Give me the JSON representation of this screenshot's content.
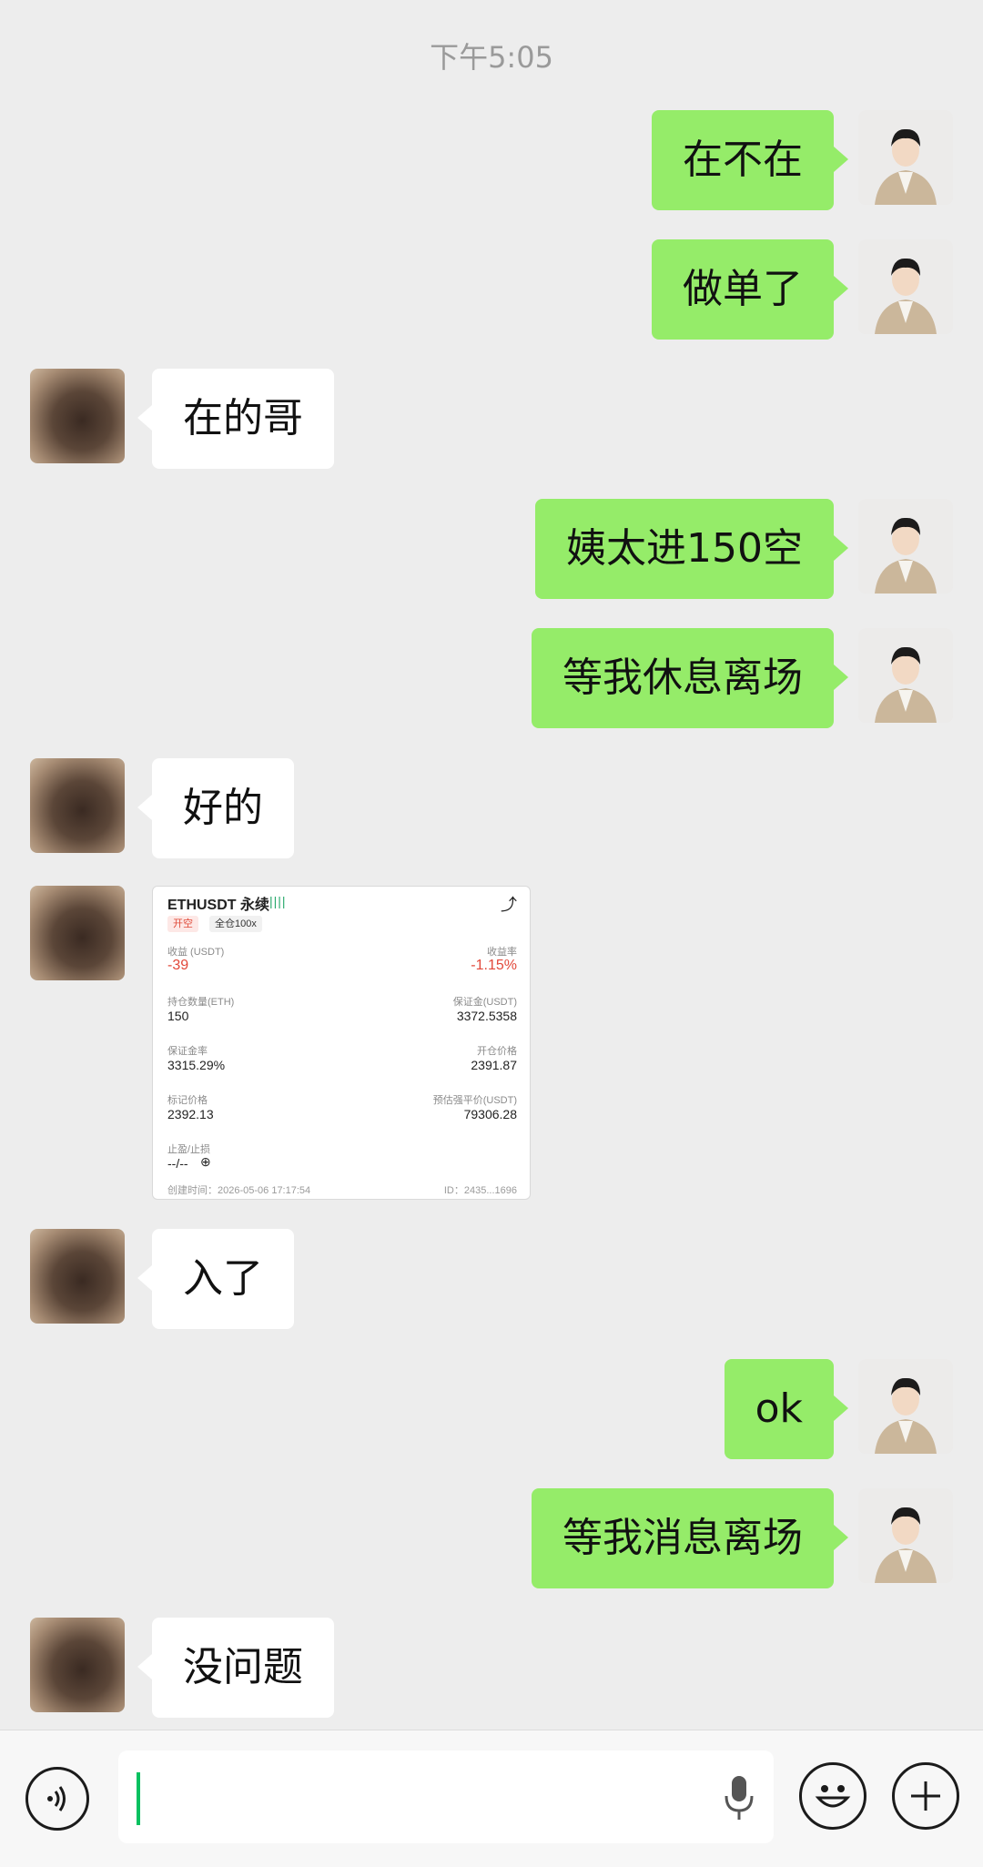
{
  "timestamp": "下午5:05",
  "messages": [
    {
      "side": "me",
      "text": "在不在"
    },
    {
      "side": "me",
      "text": "做单了"
    },
    {
      "side": "peer",
      "text": "在的哥"
    },
    {
      "side": "me",
      "text": "姨太进150空"
    },
    {
      "side": "me",
      "text": "等我休息离场"
    },
    {
      "side": "peer",
      "text": "好的"
    },
    {
      "side": "peer",
      "text": "入了"
    },
    {
      "side": "me",
      "text": "ok"
    },
    {
      "side": "me",
      "text": "等我消息离场"
    },
    {
      "side": "peer",
      "text": "没问题"
    }
  ],
  "card": {
    "title": "ETHUSDT 永续",
    "bars": "||||",
    "share_icon": "share-icon",
    "tag_open": "开空",
    "tag_cross": "全仓100x",
    "pnl_label": "收益 (USDT)",
    "pnl_value": "-39",
    "roe_label": "收益率",
    "roe_value": "-1.15%",
    "qty_label": "持仓数量(ETH)",
    "qty_value": "150",
    "margin_label": "保证金(USDT)",
    "margin_value": "3372.5358",
    "margin_ratio_label": "保证金率",
    "margin_ratio_value": "3315.29%",
    "open_price_label": "开仓价格",
    "open_price_value": "2391.87",
    "mark_price_label": "标记价格",
    "mark_price_value": "2392.13",
    "liq_price_label": "预估强平价(USDT)",
    "liq_price_value": "79306.28",
    "tpsl_label": "止盈/止损",
    "tpsl_value": "--/--",
    "created": "创建时间：2026-05-06 17:17:54",
    "id": "ID：2435...1696"
  },
  "input_bar": {
    "voice_icon": "voice-icon",
    "mic_icon": "mic-icon",
    "emoji_icon": "emoji-icon",
    "plus_icon": "plus-icon"
  },
  "colors": {
    "background": "#ededed",
    "my_bubble": "#95ec69",
    "peer_bubble": "#ffffff",
    "loss_red": "#e2483a",
    "cursor_green": "#07c160"
  }
}
